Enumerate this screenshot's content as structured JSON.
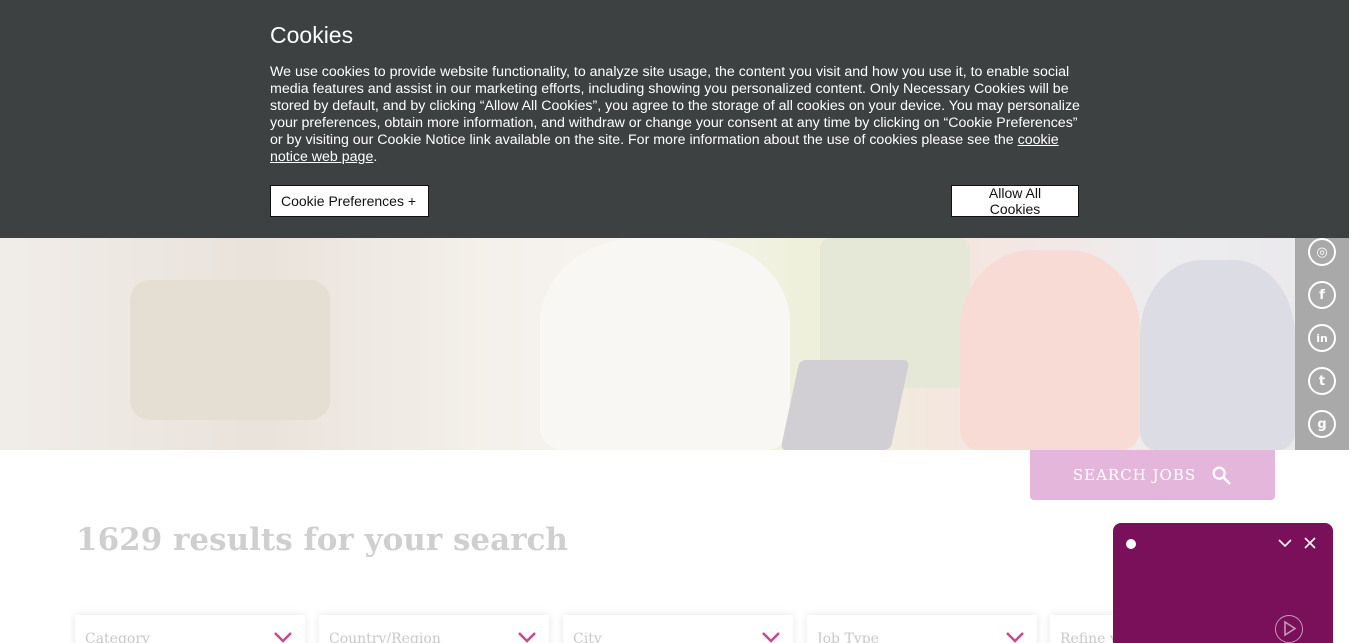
{
  "cookie_banner": {
    "title": "Cookies",
    "text": "We use cookies to provide website functionality, to analyze site usage, the content you visit and how you use it, to enable social media features and assist in our marketing efforts, including showing you personalized content. Only Necessary Cookies will be stored by default, and by clicking “Allow All Cookies”, you agree to the storage of all cookies on your device. You may personalize your preferences, obtain more information, and withdraw or change your consent at any time by clicking on “Cookie Preferences” or by visiting our Cookie Notice link available on the site. For more information about the use of cookies please see the ",
    "link_text": "cookie notice web page",
    "text_end": ".",
    "preferences_button": "Cookie Preferences  +",
    "allow_button": "Allow All Cookies"
  },
  "social": [
    {
      "name": "instagram-icon",
      "glyph": "◎"
    },
    {
      "name": "facebook-icon",
      "glyph": "f"
    },
    {
      "name": "linkedin-icon",
      "glyph": "in"
    },
    {
      "name": "twitter-icon",
      "glyph": "t"
    },
    {
      "name": "glassdoor-icon",
      "glyph": "g"
    }
  ],
  "search": {
    "label": "SEARCH JOBS"
  },
  "results": {
    "title": "1629 results for your search"
  },
  "filters": [
    "Category",
    "Country/Region",
    "City",
    "Job Type",
    "Refine y"
  ],
  "colors": {
    "chat_bg": "#7a0f5a",
    "search_btn": "#e4b6dc",
    "banner": "#3d4142",
    "chevron": "#c9478f"
  }
}
